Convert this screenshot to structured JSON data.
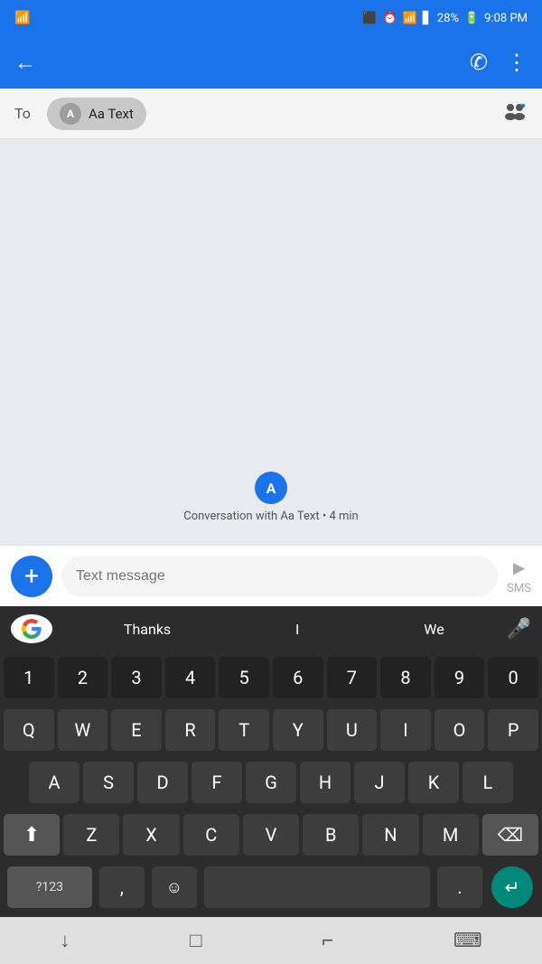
{
  "statusBar": {
    "time": "9:08 PM",
    "battery": "28%",
    "signal": "▲"
  },
  "appBar": {
    "backIcon": "←",
    "phoneIcon": "✆",
    "menuIcon": "⋮"
  },
  "toField": {
    "label": "To",
    "chipAvatar": "A",
    "chipName": "Aa Text",
    "addGroupIcon": "👥"
  },
  "conversation": {
    "avatarLetter": "A",
    "label": "Conversation with Aa Text • 4 min"
  },
  "inputBar": {
    "addIcon": "+",
    "placeholder": "Text message",
    "sendLabel": "SMS"
  },
  "keyboard": {
    "suggestions": [
      "Thanks",
      "I",
      "We"
    ],
    "rows": [
      [
        "1",
        "2",
        "3",
        "4",
        "5",
        "6",
        "7",
        "8",
        "9",
        "0"
      ],
      [
        "Q",
        "W",
        "E",
        "R",
        "T",
        "Y",
        "U",
        "I",
        "O",
        "P"
      ],
      [
        "A",
        "S",
        "D",
        "F",
        "G",
        "H",
        "J",
        "K",
        "L"
      ],
      [
        "Z",
        "X",
        "C",
        "V",
        "B",
        "N",
        "M"
      ],
      [
        "?123",
        ",",
        "☺",
        "",
        ".",
        "↵"
      ]
    ]
  },
  "navBar": {
    "downIcon": "↓",
    "squareIcon": "□",
    "backIcon": "⌐",
    "keyboardIcon": "⌨"
  }
}
